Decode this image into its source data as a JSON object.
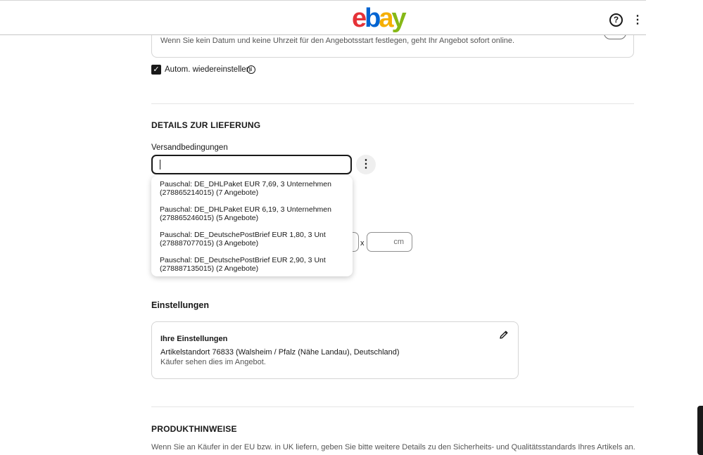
{
  "header": {
    "logo_letters": [
      {
        "char": "e",
        "color": "#e53238"
      },
      {
        "char": "b",
        "color": "#0064d2"
      },
      {
        "char": "a",
        "color": "#f5af02"
      },
      {
        "char": "y",
        "color": "#86b817"
      }
    ],
    "help_glyph": "?",
    "more_glyph": "⋮"
  },
  "start_card": {
    "text": "Wenn Sie kein Datum und keine Uhrzeit für den Angebotsstart festlegen, geht Ihr Angebot sofort online."
  },
  "relist": {
    "checked_glyph": "✓",
    "label": "Autom. wiedereinstellen",
    "info_glyph": "i"
  },
  "delivery": {
    "title": "DETAILS ZUR LIEFERUNG",
    "shipping_label": "Versandbedingungen",
    "shipping_value": "",
    "more_glyph": "⋮",
    "dimension_separator": "x",
    "dimension_unit": "cm",
    "options": [
      {
        "line1": "Pauschal: DE_DHLPaket EUR 7,69, 3 Unternehmen",
        "line2": "(278865214015) (7 Angebote)"
      },
      {
        "line1": "Pauschal: DE_DHLPaket EUR 6,19, 3 Unternehmen",
        "line2": "(278865246015) (5 Angebote)"
      },
      {
        "line1": "Pauschal: DE_DeutschePostBrief EUR 1,80, 3 Unt",
        "line2": "(278887077015) (3 Angebote)"
      },
      {
        "line1": "Pauschal: DE_DeutschePostBrief EUR 2,90, 3 Unt",
        "line2": "(278887135015) (2 Angebote)"
      }
    ]
  },
  "settings": {
    "title": "Einstellungen",
    "card_title": "Ihre Einstellungen",
    "location": "Artikelstandort 76833 (Walsheim / Pfalz (Nähe Landau), Deutschland)",
    "note": "Käufer sehen dies im Angebot."
  },
  "product_notes": {
    "title": "PRODUKTHINWEISE",
    "text": "Wenn Sie an Käufer in der EU bzw. in UK liefern, geben Sie bitte weitere Details zu den Sicherheits- und Qualitätsstandards Ihres Artikels an."
  }
}
